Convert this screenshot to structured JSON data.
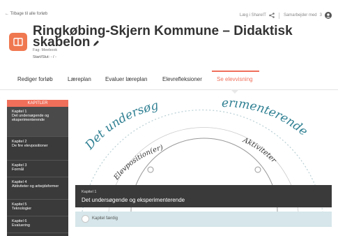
{
  "header": {
    "back_link": "← Tilbage til alle forløb",
    "share_label": "Læg i ShareIT",
    "collab_label": "Samarbejder med",
    "collab_count": "3",
    "title": "Ringkøbing-Skjern Kommune – Didaktisk skabelon",
    "subject": "Fag: Meebook",
    "dates": "Start/Slut: - / -"
  },
  "tabs": [
    {
      "label": "Rediger forløb"
    },
    {
      "label": "Læreplan"
    },
    {
      "label": "Evaluer læreplan"
    },
    {
      "label": "Elevrefleksioner"
    },
    {
      "label": "Se elevvisning"
    }
  ],
  "sidebar": {
    "header": "KAPITLER",
    "items": [
      {
        "label": "Kapitel 1\nDet undersøgende og eksperimenterende"
      },
      {
        "label": "Kapitel 2\nDe fire elevpositioner"
      },
      {
        "label": "Kapitel 3\nFormål"
      },
      {
        "label": "Kapitel 4\nAktiviteter og arbejdsformer"
      },
      {
        "label": "Kapitel 5\nTeknologier"
      },
      {
        "label": "Kapitel 6\nEvaluering"
      }
    ]
  },
  "wheel": {
    "arc_text_left": "Det undersøg",
    "arc_text_right": "erimenterende",
    "label_left": "Elevposition(er)",
    "label_right": "Aktiviteter"
  },
  "chapter": {
    "label": "Kapitel 1",
    "title": "Det undersøgende og eksperimenterende",
    "status": "Kapitel færdig"
  },
  "colors": {
    "accent": "#ef6f5b",
    "dark": "#3a3a3a",
    "status_bg": "#d6e6ea"
  }
}
